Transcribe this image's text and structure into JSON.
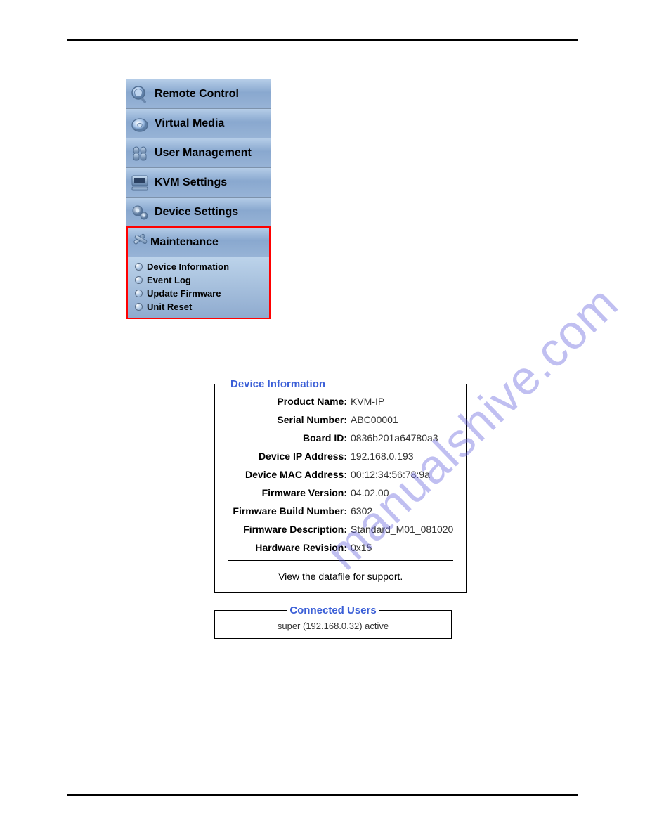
{
  "nav": {
    "items": [
      {
        "label": "Remote Control"
      },
      {
        "label": "Virtual Media"
      },
      {
        "label": "User Management"
      },
      {
        "label": "KVM Settings"
      },
      {
        "label": "Device Settings"
      }
    ],
    "expanded": {
      "label": "Maintenance",
      "sub": [
        {
          "label": "Device Information"
        },
        {
          "label": "Event Log"
        },
        {
          "label": "Update Firmware"
        },
        {
          "label": "Unit Reset"
        }
      ]
    }
  },
  "device_info": {
    "legend": "Device Information",
    "rows": [
      {
        "label": "Product Name:",
        "value": "KVM-IP"
      },
      {
        "label": "Serial Number:",
        "value": "ABC00001"
      },
      {
        "label": "Board ID:",
        "value": "0836b201a64780a3"
      },
      {
        "label": "Device IP Address:",
        "value": "192.168.0.193"
      },
      {
        "label": "Device MAC Address:",
        "value": "00:12:34:56:78:9a"
      },
      {
        "label": "Firmware Version:",
        "value": "04.02.00"
      },
      {
        "label": "Firmware Build Number:",
        "value": "6302"
      },
      {
        "label": "Firmware Description:",
        "value": "Standard_M01_081020"
      },
      {
        "label": "Hardware Revision:",
        "value": "0x15"
      }
    ],
    "link": "View the datafile for support."
  },
  "connected_users": {
    "legend": "Connected Users",
    "text": "super (192.168.0.32)  active"
  },
  "watermark": "manualshive.com"
}
